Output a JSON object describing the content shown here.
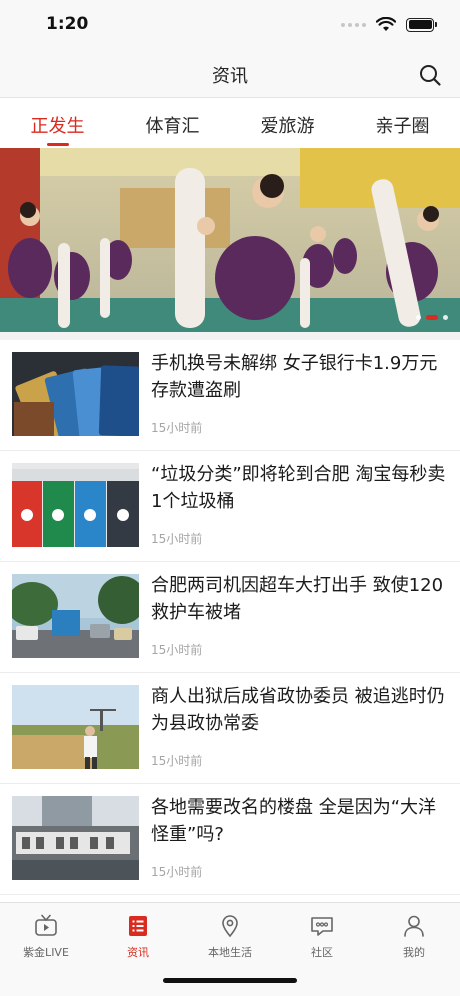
{
  "status_bar": {
    "time": "1:20"
  },
  "nav": {
    "title": "资讯",
    "search_icon": "search-icon"
  },
  "tabs": [
    {
      "label": "正发生",
      "active": true
    },
    {
      "label": "体育汇",
      "active": false
    },
    {
      "label": "爱旅游",
      "active": false
    },
    {
      "label": "亲子圈",
      "active": false
    }
  ],
  "banner": {
    "image": "children-ballet-class-photo",
    "slide_count": 3,
    "active_slide": 2
  },
  "news": [
    {
      "title": "手机换号未解绑 女子银行卡1.9万元存款遭盗刷",
      "time": "15小时前",
      "thumb": "bank-cards-photo"
    },
    {
      "title": "“垃圾分类”即将轮到合肥 淘宝每秒卖1个垃圾桶",
      "time": "15小时前",
      "thumb": "trash-bins-photo"
    },
    {
      "title": "合肥两司机因超车大打出手 致使120救护车被堵",
      "time": "15小时前",
      "thumb": "street-traffic-photo"
    },
    {
      "title": "商人出狱后成省政协委员 被追逃时仍为县政协常委",
      "time": "15小时前",
      "thumb": "construction-site-photo"
    },
    {
      "title": "各地需要改名的楼盘 全是因为“大洋怪重”吗?",
      "time": "15小时前",
      "thumb": "building-sign-photo"
    }
  ],
  "tabbar": [
    {
      "label": "紫金LIVE",
      "icon": "tv-icon",
      "active": false
    },
    {
      "label": "资讯",
      "icon": "news-list-icon",
      "active": true
    },
    {
      "label": "本地生活",
      "icon": "location-pin-icon",
      "active": false
    },
    {
      "label": "社区",
      "icon": "chat-bubble-icon",
      "active": false
    },
    {
      "label": "我的",
      "icon": "person-icon",
      "active": false
    }
  ],
  "colors": {
    "accent": "#d92b1f",
    "text": "#1b1b1b",
    "muted": "#a5a5a5",
    "bar_bg": "#f8f8f8"
  }
}
